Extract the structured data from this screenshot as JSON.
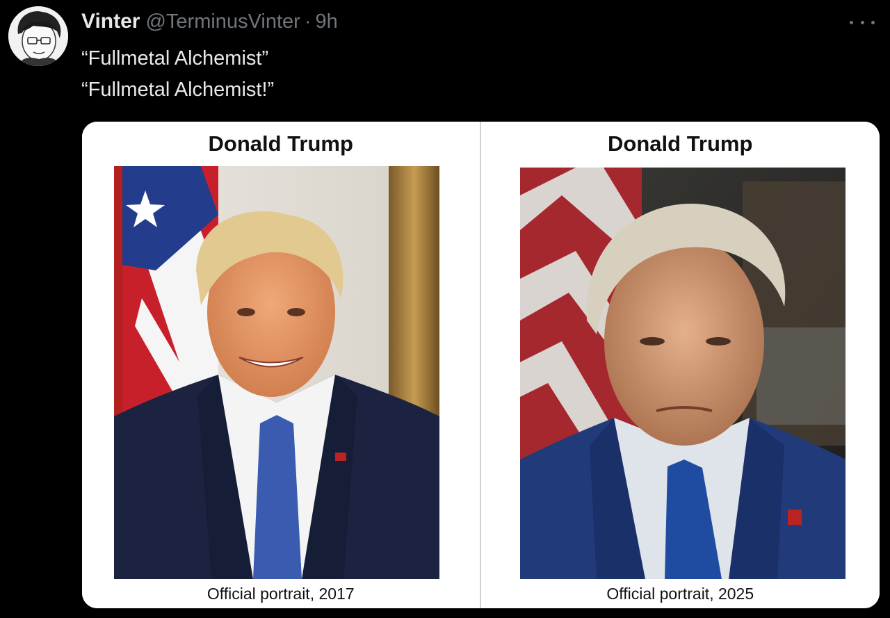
{
  "tweet": {
    "display_name": "Vinter",
    "handle": "@TerminusVinter",
    "separator": "·",
    "time": "9h",
    "lines": [
      "“Fullmetal Alchemist”",
      "“Fullmetal Alchemist!”"
    ]
  },
  "media": {
    "left": {
      "title": "Donald Trump",
      "caption": "Official portrait, 2017"
    },
    "right": {
      "title": "Donald Trump",
      "caption": "Official portrait, 2025"
    }
  },
  "icons": {
    "avatar": "avatar-icon",
    "more": "more-options-icon"
  }
}
